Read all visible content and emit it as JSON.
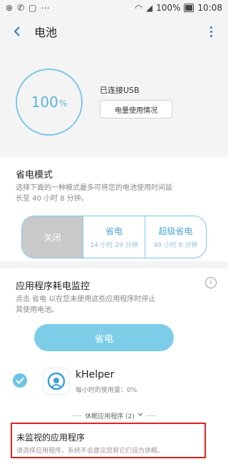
{
  "status_bar": {
    "battery_text": "100%",
    "time": "10:08"
  },
  "header": {
    "title": "电池"
  },
  "battery": {
    "level": "100",
    "percent_sign": "%",
    "connection": "已连接USB",
    "usage_button": "电量使用情况"
  },
  "power_saving": {
    "title": "省电模式",
    "description_line1": "选择下面的一种模式最多可将您的电池使用时间延",
    "description_line2": "长至 40 小时 8 分钟。",
    "modes": [
      {
        "label": "关闭",
        "sub": ""
      },
      {
        "label": "省电",
        "sub": "14 小时 29 分钟"
      },
      {
        "label": "超级省电",
        "sub": "40 小时 8 分钟"
      }
    ]
  },
  "monitor": {
    "title": "应用程序耗电监控",
    "description_line1": "点击 省电 以在您未使用这些应用程序时停止",
    "description_line2": "其使用电池。",
    "save_button": "省电",
    "app": {
      "name": "kHelper",
      "usage": "每小时的使用量：0%"
    },
    "sleeping_apps": "休眠应用程序 (2)",
    "unmonitored": {
      "title": "未监视的应用程序",
      "description": "请选择应用程序，系统不会建议您将它们设为休眠。"
    }
  },
  "colors": {
    "accent": "#7dcde8",
    "highlight": "#e52020"
  }
}
